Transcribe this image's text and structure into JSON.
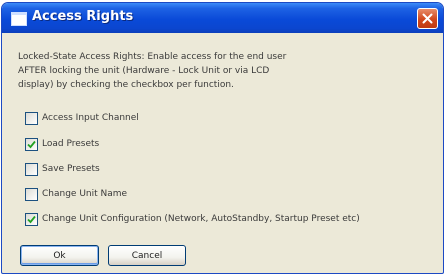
{
  "window": {
    "title": "Access Rights",
    "icon": "window-icon",
    "close_icon": "close-icon"
  },
  "description": {
    "line1": "Locked-State Access Rights: Enable access for the end user",
    "line2": "AFTER locking the unit (Hardware - Lock Unit or via LCD",
    "line3": "display) by checking the checkbox per function."
  },
  "options": [
    {
      "label": "Access Input Channel",
      "checked": false
    },
    {
      "label": "Load Presets",
      "checked": true
    },
    {
      "label": "Save Presets",
      "checked": false
    },
    {
      "label": "Change Unit Name",
      "checked": false
    },
    {
      "label": "Change Unit Configuration (Network, AutoStandby, Startup Preset etc)",
      "checked": true
    }
  ],
  "buttons": {
    "ok": "Ok",
    "cancel": "Cancel"
  },
  "colors": {
    "title_bar": "#0a4ad8",
    "window_bg": "#ece9d8",
    "check_mark": "#21a121",
    "close_button": "#d1471c"
  }
}
